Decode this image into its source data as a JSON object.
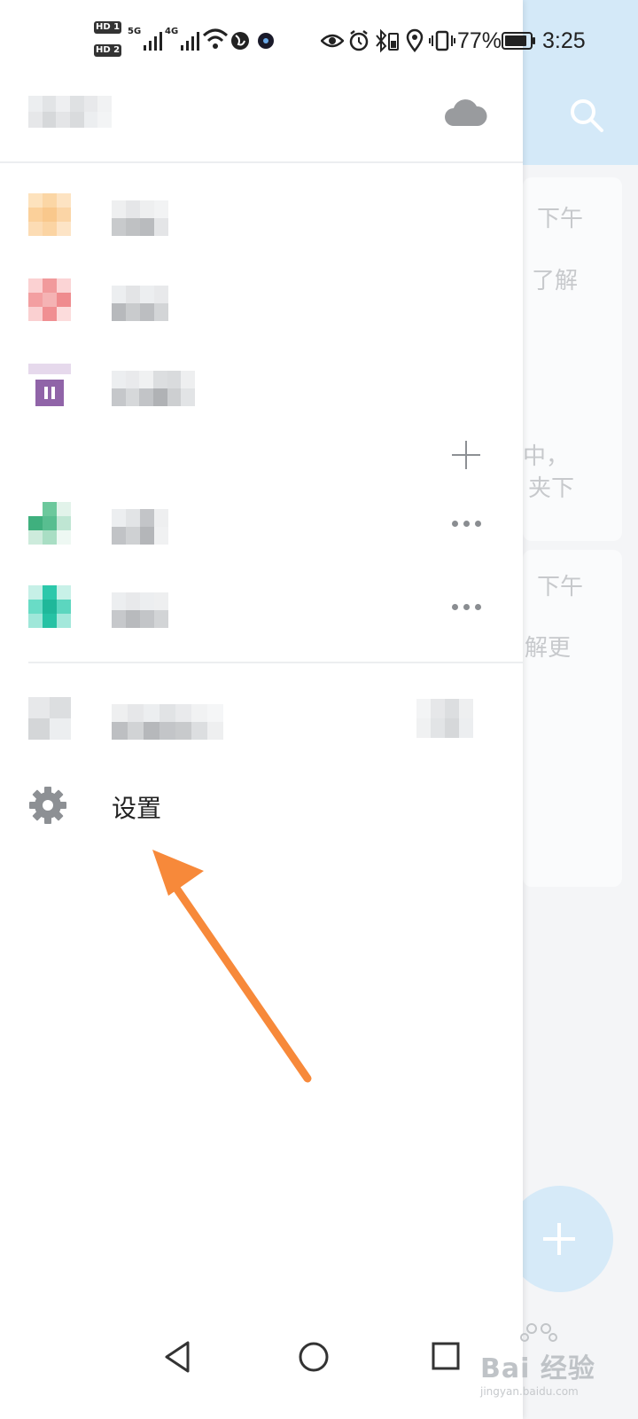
{
  "status_bar": {
    "hd_badges": [
      "HD 1",
      "HD 2"
    ],
    "signal_labels": [
      "5G",
      "4G"
    ],
    "battery_percent": "77%",
    "time": "3:25"
  },
  "background_app": {
    "card_1_lines": [
      "下午",
      "了解",
      "中，",
      "夹下"
    ],
    "card_2_lines": [
      "下午",
      "解更"
    ]
  },
  "drawer": {
    "cloud_icon": "cloud-icon",
    "items": [
      {
        "icon": "folder-icon-orange",
        "color": "#fbd3a3"
      },
      {
        "icon": "folder-icon-red",
        "color": "#f0868a"
      },
      {
        "icon": "trash-icon",
        "color": "#9166a8"
      },
      {
        "icon": "tag-icon-green",
        "color": "#4cbf8c",
        "more": true
      },
      {
        "icon": "folder-icon-teal",
        "color": "#31cdb2",
        "more": true
      }
    ],
    "settings_label": "设置"
  },
  "annotation": {
    "arrow_color": "#f7893a"
  },
  "watermark": {
    "text": "Bai 经验",
    "url": "jingyan.baidu.com"
  }
}
